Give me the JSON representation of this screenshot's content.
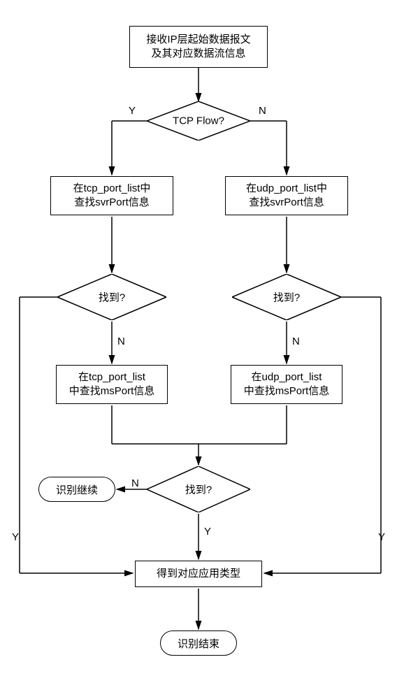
{
  "nodes": {
    "start": "接收IP层起始数据报文\n及其对应数据流信息",
    "tcpflow": "TCP Flow?",
    "tcp_lookup_svr": "在tcp_port_list中\n查找svrPort信息",
    "udp_lookup_svr": "在udp_port_list中\n查找svrPort信息",
    "found_left": "找到?",
    "found_right": "找到?",
    "tcp_lookup_ms": "在tcp_port_list\n中查找msPort信息",
    "udp_lookup_ms": "在udp_port_list\n中查找msPort信息",
    "found_bottom": "找到?",
    "continue": "识别继续",
    "result": "得到对应应用类型",
    "end": "识别结束"
  },
  "labels": {
    "y": "Y",
    "n": "N"
  }
}
